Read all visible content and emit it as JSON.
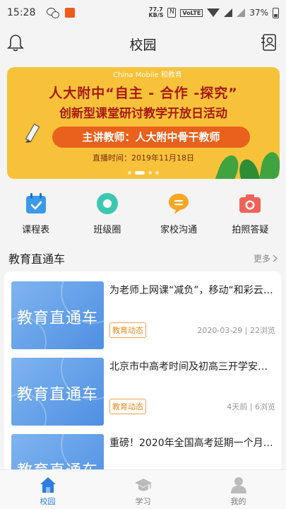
{
  "status_bar": {
    "time": "15:28",
    "net_speed_value": "77.7",
    "net_speed_unit": "KB/S",
    "nfc": "N",
    "volte": "VoLTE",
    "battery": "37%"
  },
  "header": {
    "title": "校园"
  },
  "banner": {
    "logo_text": "China Mobile  和教育",
    "line1": "人大附中“自主 - 合作 -探究”",
    "line2": "创新型课堂研讨教学开放日活动",
    "speaker": "主讲教师：人大附中骨干教师",
    "date": "直播时间：2019年11月18日",
    "slide_count": 4,
    "active_slide": 2
  },
  "shortcuts": [
    {
      "label": "课程表",
      "icon": "calendar-icon",
      "color": "#3a9ae8"
    },
    {
      "label": "班级圈",
      "icon": "circle-icon",
      "color": "#3ec7b0"
    },
    {
      "label": "家校沟通",
      "icon": "chat-bubble-icon",
      "color": "#f5a623"
    },
    {
      "label": "拍照答疑",
      "icon": "camera-icon",
      "color": "#f0625a"
    }
  ],
  "section": {
    "title": "教育直通车",
    "more": "更多"
  },
  "articles": [
    {
      "thumb_text": "教育直通车",
      "title": "为老师上网课“减负”，移动“和彩云…",
      "tag": "教育动态",
      "meta": "2020-03-29 | 22浏览"
    },
    {
      "thumb_text": "教育直通车",
      "title": "北京市中高考时间及初高三开学安…",
      "tag": "教育动态",
      "meta": "4天前 | 6浏览"
    },
    {
      "thumb_text": "教育直通车",
      "title": "重磅！2020年全国高考延期一个月…",
      "tag": "",
      "meta": ""
    }
  ],
  "tabbar": [
    {
      "label": "校园",
      "icon": "house-icon",
      "active": true
    },
    {
      "label": "学习",
      "icon": "graduation-cap-icon",
      "active": false
    },
    {
      "label": "我的",
      "icon": "user-icon",
      "active": false
    }
  ],
  "colors": {
    "accent": "#2a7de1",
    "banner_bg": "#f7c23a",
    "banner_text": "#a61a10",
    "tag": "#e88a20"
  }
}
